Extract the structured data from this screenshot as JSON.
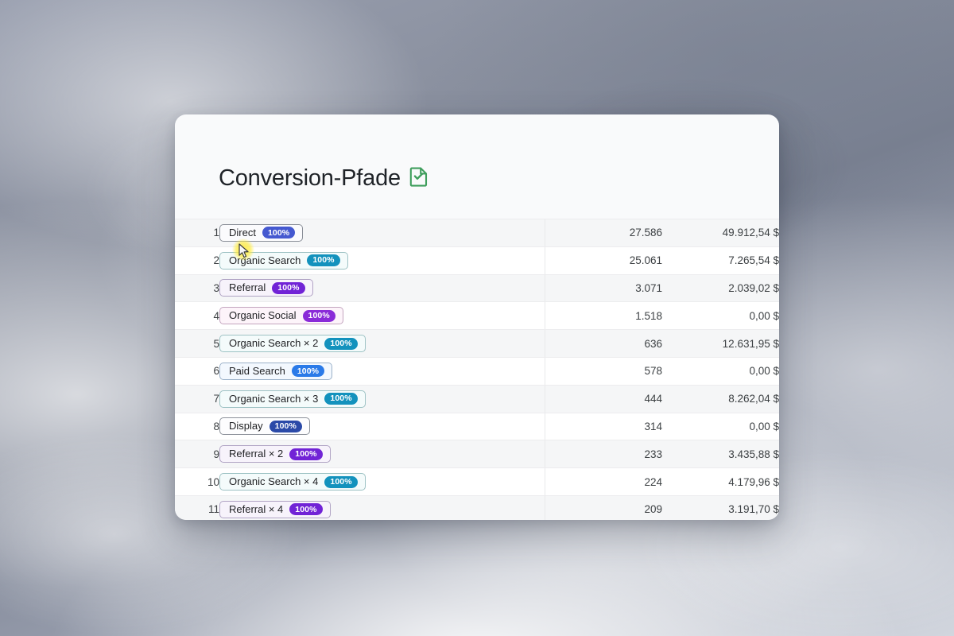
{
  "page": {
    "background_description": "misty gray-blue cloud photograph"
  },
  "card": {
    "title": "Conversion-Pfade",
    "title_icon": "document-check-icon",
    "title_icon_color": "#3f9e5c"
  },
  "table": {
    "rows": [
      {
        "index": "1",
        "path": "Direct",
        "channel": "direct",
        "percent": "100%",
        "conversions": "27.586",
        "value": "49.912,54 $"
      },
      {
        "index": "2",
        "path": "Organic Search",
        "channel": "organic-search",
        "percent": "100%",
        "conversions": "25.061",
        "value": "7.265,54 $"
      },
      {
        "index": "3",
        "path": "Referral",
        "channel": "referral",
        "percent": "100%",
        "conversions": "3.071",
        "value": "2.039,02 $"
      },
      {
        "index": "4",
        "path": "Organic Social",
        "channel": "organic-social",
        "percent": "100%",
        "conversions": "1.518",
        "value": "0,00 $"
      },
      {
        "index": "5",
        "path": "Organic Search × 2",
        "channel": "organic-search",
        "percent": "100%",
        "conversions": "636",
        "value": "12.631,95 $"
      },
      {
        "index": "6",
        "path": "Paid Search",
        "channel": "paid-search",
        "percent": "100%",
        "conversions": "578",
        "value": "0,00 $"
      },
      {
        "index": "7",
        "path": "Organic Search × 3",
        "channel": "organic-search",
        "percent": "100%",
        "conversions": "444",
        "value": "8.262,04 $"
      },
      {
        "index": "8",
        "path": "Display",
        "channel": "display",
        "percent": "100%",
        "conversions": "314",
        "value": "0,00 $"
      },
      {
        "index": "9",
        "path": "Referral × 2",
        "channel": "referral",
        "percent": "100%",
        "conversions": "233",
        "value": "3.435,88 $"
      },
      {
        "index": "10",
        "path": "Organic Search × 4",
        "channel": "organic-search",
        "percent": "100%",
        "conversions": "224",
        "value": "4.179,96 $"
      },
      {
        "index": "11",
        "path": "Referral × 4",
        "channel": "referral",
        "percent": "100%",
        "conversions": "209",
        "value": "3.191,70 $"
      }
    ]
  },
  "cursor": {
    "icon": "mouse-pointer-icon",
    "highlight_color": "#ffec40"
  }
}
